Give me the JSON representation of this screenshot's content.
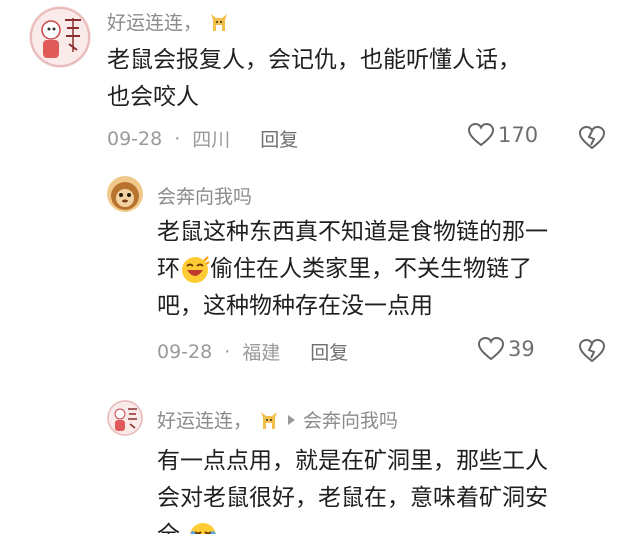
{
  "comments": [
    {
      "username": "好运连连，",
      "text": "老鼠会报复人，会记仇，也能听懂人话，也会咬人",
      "line1": "老鼠会报复人，会记仇，也能听懂人话，",
      "line2": "也会咬人",
      "date": "09-28",
      "dot": "·",
      "location": "四川",
      "reply_label": "回复",
      "likes": "170"
    }
  ],
  "replies": [
    {
      "username": "会奔向我吗",
      "line1": "老鼠这种东西真不知道是食物链的那一",
      "line2_a": "环",
      "line2_b": "偷住在人类家里，不关生物链了",
      "line3": "吧，这种物种存在没一点用",
      "date": "09-28",
      "dot": "·",
      "location": "福建",
      "reply_label": "回复",
      "likes": "39"
    },
    {
      "username": "好运连连，",
      "reply_to": "会奔向我吗",
      "line1": "有一点点用，就是在矿洞里，那些工人",
      "line2": "会对老鼠很好，老鼠在，意味着矿洞安",
      "line3": "全"
    }
  ],
  "icons": {
    "like": "heart-icon",
    "dislike": "broken-heart-icon",
    "badge": "cat-icon",
    "emoji_laugh": "laughing-emoji",
    "emoji_cry": "crying-laughing-emoji"
  },
  "colors": {
    "username": "#8c8c8c",
    "text": "#1f1f1f",
    "meta": "#9a9a9a"
  }
}
